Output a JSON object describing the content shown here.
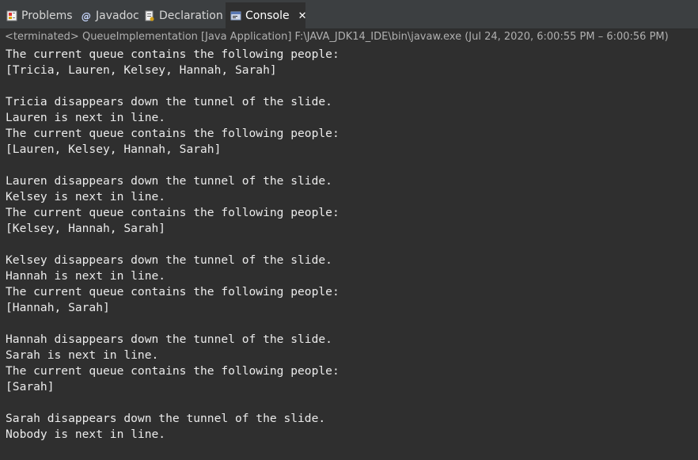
{
  "tabs": [
    {
      "label": "Problems",
      "icon": "problems-icon"
    },
    {
      "label": "Javadoc",
      "icon": "javadoc-icon"
    },
    {
      "label": "Declaration",
      "icon": "declaration-icon"
    },
    {
      "label": "Console",
      "icon": "console-icon",
      "active": true,
      "close": "✕"
    }
  ],
  "status": {
    "text": "<terminated> QueueImplementation [Java Application] F:\\JAVA_JDK14_IDE\\bin\\javaw.exe  (Jul 24, 2020, 6:00:55 PM – 6:00:56 PM)"
  },
  "console": {
    "lines": [
      "The current queue contains the following people:",
      "[Tricia, Lauren, Kelsey, Hannah, Sarah]",
      "",
      "Tricia disappears down the tunnel of the slide.",
      "Lauren is next in line.",
      "The current queue contains the following people:",
      "[Lauren, Kelsey, Hannah, Sarah]",
      "",
      "Lauren disappears down the tunnel of the slide.",
      "Kelsey is next in line.",
      "The current queue contains the following people:",
      "[Kelsey, Hannah, Sarah]",
      "",
      "Kelsey disappears down the tunnel of the slide.",
      "Hannah is next in line.",
      "The current queue contains the following people:",
      "[Hannah, Sarah]",
      "",
      "Hannah disappears down the tunnel of the slide.",
      "Sarah is next in line.",
      "The current queue contains the following people:",
      "[Sarah]",
      "",
      "Sarah disappears down the tunnel of the slide.",
      "Nobody is next in line."
    ]
  },
  "colors": {
    "background": "#2f2f2f",
    "tabbar": "#3c3f41",
    "text": "#ebebeb",
    "status_text": "#b0b0b0"
  }
}
